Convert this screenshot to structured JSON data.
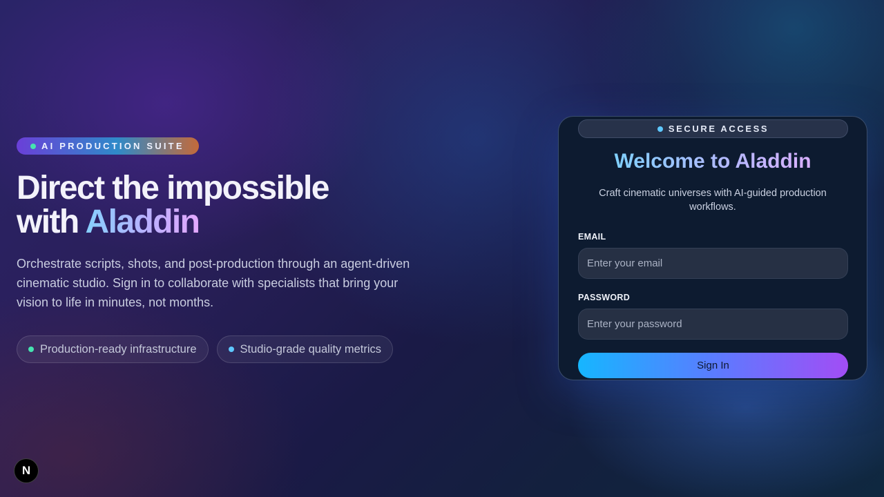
{
  "hero": {
    "badge_label": "AI PRODUCTION SUITE",
    "headline_line1": "Direct the impossible",
    "headline_prefix": "with ",
    "headline_accent": "Aladdin",
    "lede": "Orchestrate scripts, shots, and post-production through an agent-driven cinematic studio. Sign in to collaborate with specialists that bring your vision to life in minutes, not months.",
    "chips": [
      {
        "label": "Production-ready infrastructure",
        "dot_color": "#46e3b0"
      },
      {
        "label": "Studio-grade quality metrics",
        "dot_color": "#5ec8ff"
      }
    ]
  },
  "login": {
    "tag_label": "SECURE ACCESS",
    "title": "Welcome to Aladdin",
    "subtitle": "Craft cinematic universes with AI-guided production workflows.",
    "email_label": "EMAIL",
    "email_placeholder": "Enter your email",
    "email_value": "",
    "password_label": "PASSWORD",
    "password_placeholder": "Enter your password",
    "password_value": "",
    "submit_label": "Sign In"
  },
  "dev_badge": {
    "letter": "N",
    "icon": "nextjs-icon"
  },
  "colors": {
    "accent_start": "#16b6ff",
    "accent_end": "#a24df5",
    "card_background": "#0d1b30"
  }
}
